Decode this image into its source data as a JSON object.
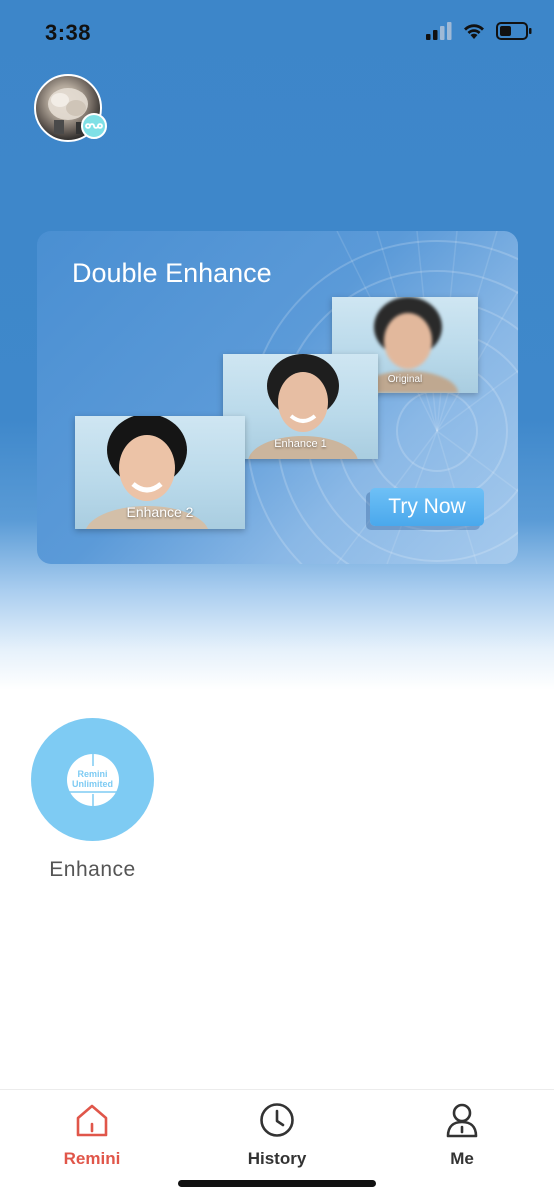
{
  "status_bar": {
    "time": "3:38"
  },
  "banner": {
    "title": "Double Enhance",
    "photos": {
      "original": "Original",
      "enhance_1": "Enhance 1",
      "enhance_2": "Enhance 2"
    },
    "cta_label": "Try Now"
  },
  "tools": {
    "enhance": {
      "badge_line1": "Remini",
      "badge_line2": "Unlimited",
      "label": "Enhance"
    }
  },
  "tabbar": {
    "tabs": [
      {
        "label": "Remini",
        "icon": "home-icon",
        "active": true
      },
      {
        "label": "History",
        "icon": "clock-icon",
        "active": false
      },
      {
        "label": "Me",
        "icon": "person-icon",
        "active": false
      }
    ],
    "active_color": "#e0564a",
    "inactive_color": "#333333"
  },
  "colors": {
    "header_blue": "#3f88cb",
    "enhance_blue": "#7ecbf3",
    "badge_teal": "#7fe0e6"
  }
}
